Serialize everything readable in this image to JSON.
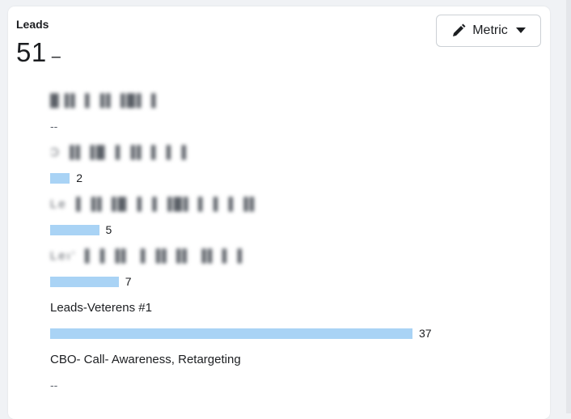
{
  "card": {
    "title": "Leads",
    "total": "51",
    "total_delta": "–"
  },
  "metric_button": {
    "label": "Metric",
    "icon": "pencil-icon",
    "dropdown_icon": "caret-down-icon"
  },
  "colors": {
    "bar": "#a9d3f5",
    "text": "#1c1e21"
  },
  "breakdown": [
    {
      "label": "█▐▌▐ ▐▌▐█▌▐",
      "blurred": true,
      "value": null,
      "value_text": "--"
    },
    {
      "label": "Ɔ ▐▌▐█ ▐ ▐▌▐ ▐ ▐",
      "blurred": true,
      "value": 2,
      "value_text": "2"
    },
    {
      "label": "Le ▐ ▐▌▐█ ▐ ▐ ▐█▌▐ ▐ ▐ ▐▌",
      "blurred": true,
      "value": 5,
      "value_text": "5"
    },
    {
      "label": "Leı’ ▐ ▐ ▐▌ ▐ ▐▌▐▌ ▐▌▐ ▐",
      "blurred": true,
      "value": 7,
      "value_text": "7"
    },
    {
      "label": "Leads-Veterens #1",
      "blurred": false,
      "value": 37,
      "value_text": "37"
    },
    {
      "label": "CBO- Call- Awareness, Retargeting",
      "blurred": false,
      "value": null,
      "value_text": "--"
    }
  ]
}
